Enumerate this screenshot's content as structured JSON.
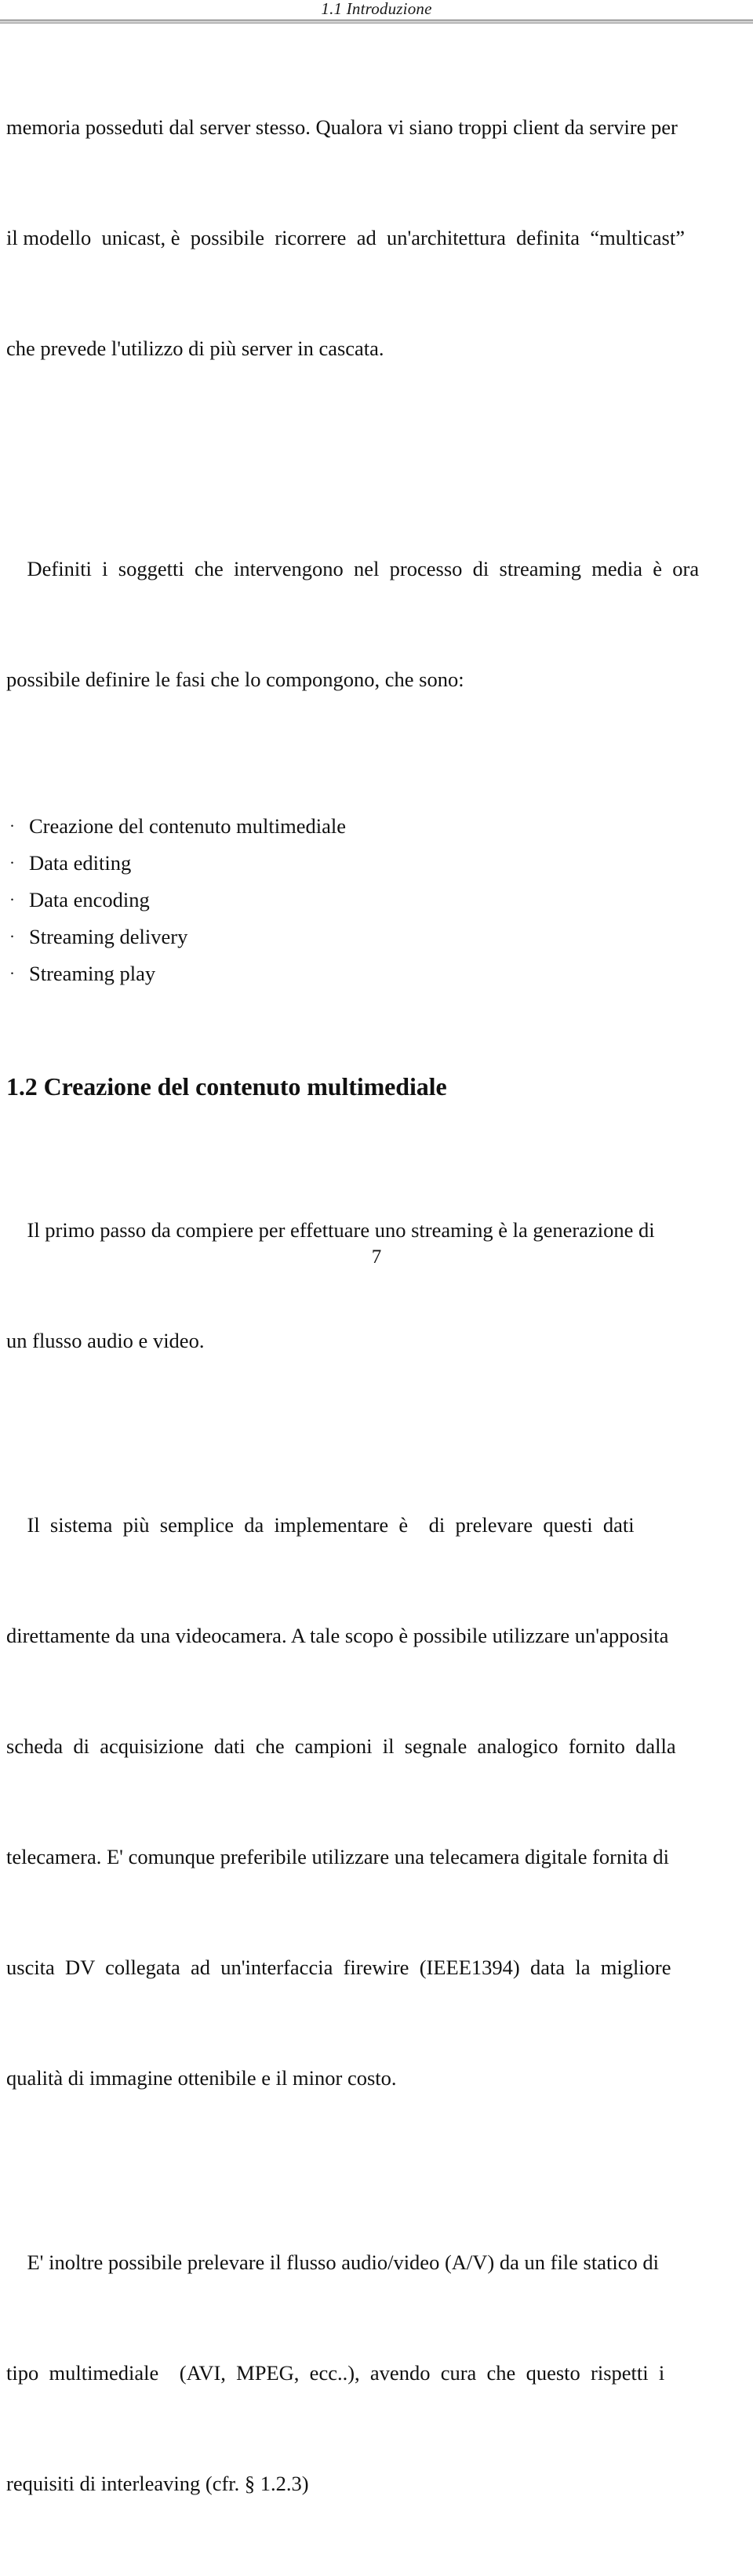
{
  "header": {
    "title": "1.1 Introduzione"
  },
  "body": {
    "paragraph_1": {
      "lines": [
        "memoria posseduti dal server stesso. Qualora vi siano troppi client da servire per",
        "il modello  unicast, è  possibile  ricorrere  ad  un'architettura  definita  “multicast”",
        "che prevede l'utilizzo di più server in cascata."
      ]
    },
    "paragraph_2": {
      "lines": [
        "    Definiti  i  soggetti  che  intervengono  nel  processo  di  streaming  media  è  ora",
        "possibile definire le fasi che lo compongono, che sono:"
      ]
    },
    "bullet_list": {
      "bullet_glyph": "·",
      "items": [
        "Creazione del contenuto multimediale",
        "Data editing",
        "Data encoding",
        "Streaming delivery",
        "Streaming play"
      ]
    },
    "section_heading": "1.2 Creazione del contenuto multimediale",
    "paragraph_3": {
      "lines": [
        "    Il primo passo da compiere per effettuare uno streaming è la generazione di",
        "un flusso audio e video."
      ]
    },
    "paragraph_4": {
      "lines": [
        "    Il  sistema  più  semplice  da  implementare  è    di  prelevare  questi  dati",
        "direttamente da una videocamera. A tale scopo è possibile utilizzare un'apposita",
        "scheda  di  acquisizione  dati  che  campioni  il  segnale  analogico  fornito  dalla",
        "telecamera. E' comunque preferibile utilizzare una telecamera digitale fornita di",
        "uscita  DV  collegata  ad  un'interfaccia  firewire  (IEEE1394)  data  la  migliore",
        "qualità di immagine ottenibile e il minor costo."
      ]
    },
    "paragraph_5": {
      "lines": [
        "    E' inoltre possibile prelevare il flusso audio/video (A/V) da un file statico di",
        "tipo  multimediale    (AVI,  MPEG,  ecc..),  avendo  cura  che  questo  rispetti  i",
        "requisiti di interleaving (cfr. § 1.2.3)"
      ]
    }
  },
  "footer": {
    "page_number": "7"
  }
}
